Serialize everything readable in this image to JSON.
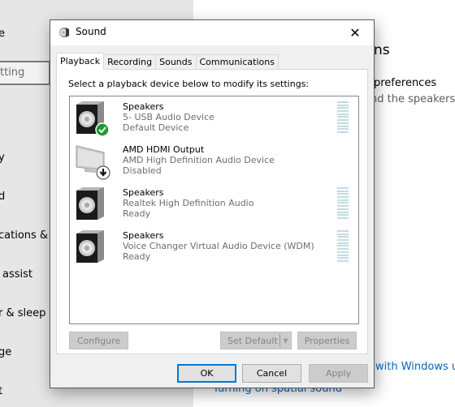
{
  "background": {
    "left_items": [
      "e",
      "y",
      "d",
      "cations & a",
      "assist",
      "r & sleep",
      "ge",
      "t"
    ],
    "search_partial": "tting",
    "right_texts": {
      "heading_partial": "ns",
      "preferences_partial": "preferences",
      "preferences_desc_partial": "nd the speakers or",
      "link1_partial": "with Windows u",
      "link2": "Turning on spatial sound"
    }
  },
  "dialog": {
    "title": "Sound",
    "close_glyph": "✕",
    "tabs": [
      {
        "label": "Playback",
        "active": true
      },
      {
        "label": "Recording",
        "active": false
      },
      {
        "label": "Sounds",
        "active": false
      },
      {
        "label": "Communications",
        "active": false
      }
    ],
    "instruction": "Select a playback device below to modify its settings:",
    "devices": [
      {
        "name": "Speakers",
        "description": "5- USB Audio Device",
        "status": "Default Device",
        "icon": "speaker-icon",
        "badge": "default-check-icon",
        "has_meter": true
      },
      {
        "name": "AMD HDMI Output",
        "description": "AMD High Definition Audio Device",
        "status": "Disabled",
        "icon": "monitor-icon",
        "badge": "disabled-down-arrow-icon",
        "has_meter": false
      },
      {
        "name": "Speakers",
        "description": "Realtek High Definition Audio",
        "status": "Ready",
        "icon": "speaker-icon",
        "badge": null,
        "has_meter": true
      },
      {
        "name": "Speakers",
        "description": "Voice Changer Virtual Audio Device (WDM)",
        "status": "Ready",
        "icon": "speaker-icon",
        "badge": null,
        "has_meter": true
      }
    ],
    "buttons": {
      "configure": "Configure",
      "set_default": "Set Default",
      "set_default_arrow": "▼",
      "properties": "Properties",
      "ok": "OK",
      "cancel": "Cancel",
      "apply": "Apply"
    }
  }
}
